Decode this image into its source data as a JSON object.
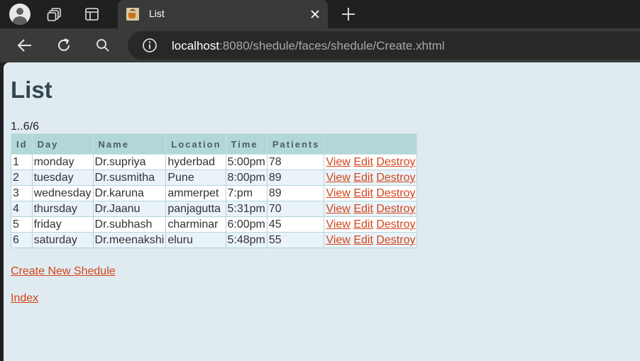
{
  "browser": {
    "tab_title": "List",
    "url_host": "localhost",
    "url_rest": ":8080/shedule/faces/shedule/Create.xhtml"
  },
  "page": {
    "title": "List",
    "range": "1..6/6",
    "columns": [
      "Id",
      "Day",
      "Name",
      "Location",
      "Time",
      "Patients",
      ""
    ],
    "rows": [
      {
        "id": "1",
        "day": "monday",
        "name": "Dr.supriya",
        "location": "hyderbad",
        "time": "5:00pm",
        "patients": "78"
      },
      {
        "id": "2",
        "day": "tuesday",
        "name": "Dr.susmitha",
        "location": "Pune",
        "time": "8:00pm",
        "patients": "89"
      },
      {
        "id": "3",
        "day": "wednesday",
        "name": "Dr.karuna",
        "location": "ammerpet",
        "time": "7:pm",
        "patients": "89"
      },
      {
        "id": "4",
        "day": "thursday",
        "name": "Dr.Jaanu",
        "location": "panjagutta",
        "time": "5:31pm",
        "patients": "70"
      },
      {
        "id": "5",
        "day": "friday",
        "name": "Dr.subhash",
        "location": "charminar",
        "time": "6:00pm",
        "patients": "45"
      },
      {
        "id": "6",
        "day": "saturday",
        "name": "Dr.meenakshi",
        "location": "eluru",
        "time": "5:48pm",
        "patients": "55"
      }
    ],
    "actions": {
      "view": "View",
      "edit": "Edit",
      "destroy": "Destroy"
    },
    "create_link": "Create New Shedule",
    "index_link": "Index"
  },
  "colors": {
    "link": "#d3451b",
    "header_bg": "#b2d7d8",
    "page_bg": "#dfebf0"
  }
}
